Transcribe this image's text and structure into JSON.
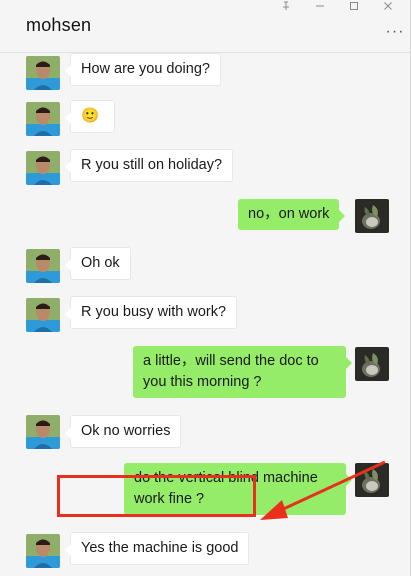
{
  "window": {
    "title": "mohsen",
    "controls": [
      "pin-icon",
      "minimize-icon",
      "maximize-icon",
      "close-icon"
    ],
    "more_glyph": "···"
  },
  "messages": [
    {
      "side": "left",
      "text": "How are you doing?"
    },
    {
      "side": "left",
      "text": "🙂"
    },
    {
      "side": "left",
      "text": "R you still on holiday?"
    },
    {
      "side": "right",
      "text": "no，on work"
    },
    {
      "side": "left",
      "text": "Oh ok"
    },
    {
      "side": "left",
      "text": "R you busy with work?"
    },
    {
      "side": "right",
      "text": "a little，will send the doc to you this morning ?"
    },
    {
      "side": "left",
      "text": "Ok no worries"
    },
    {
      "side": "right",
      "text": "do the vertical blind machine work fine ?"
    },
    {
      "side": "left",
      "text": "Yes the machine is good"
    }
  ],
  "colors": {
    "chat_background": "#f5f5f5",
    "incoming_bubble": "#ffffff",
    "outgoing_bubble": "#95ec69",
    "annotation": "#e8301c"
  }
}
